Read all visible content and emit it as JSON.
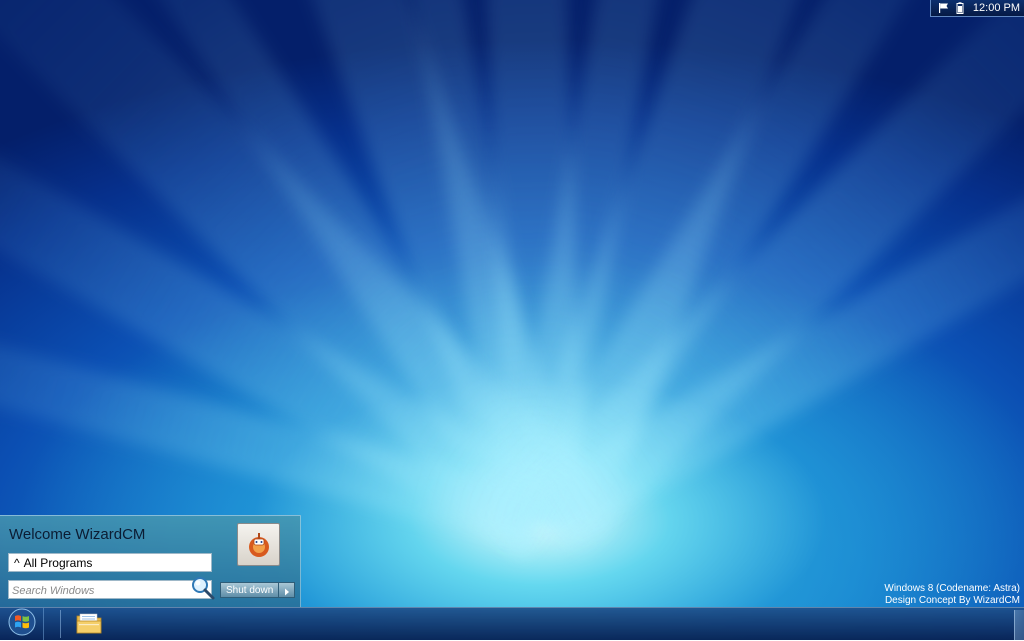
{
  "tray": {
    "time": "12:00 PM",
    "icons": [
      "flag-icon",
      "battery-icon"
    ]
  },
  "start_menu": {
    "welcome_text": "Welcome WizardCM",
    "all_programs_label": "All Programs",
    "all_programs_icon": "caret-up-icon",
    "search_placeholder": "Search Windows",
    "shutdown_label": "Shut down",
    "user_icon": "user-avatar-icon"
  },
  "watermark": {
    "line1": "Windows 8 (Codename: Astra)",
    "line2": "Design Concept By WizardCM"
  },
  "taskbar": {
    "start_icon": "windows-orb-icon",
    "pinned": [
      "folder-icon"
    ]
  },
  "colors": {
    "accent": "#1784cf",
    "taskbar": "#0b2a5e",
    "start_menu": "#3f86a6"
  }
}
